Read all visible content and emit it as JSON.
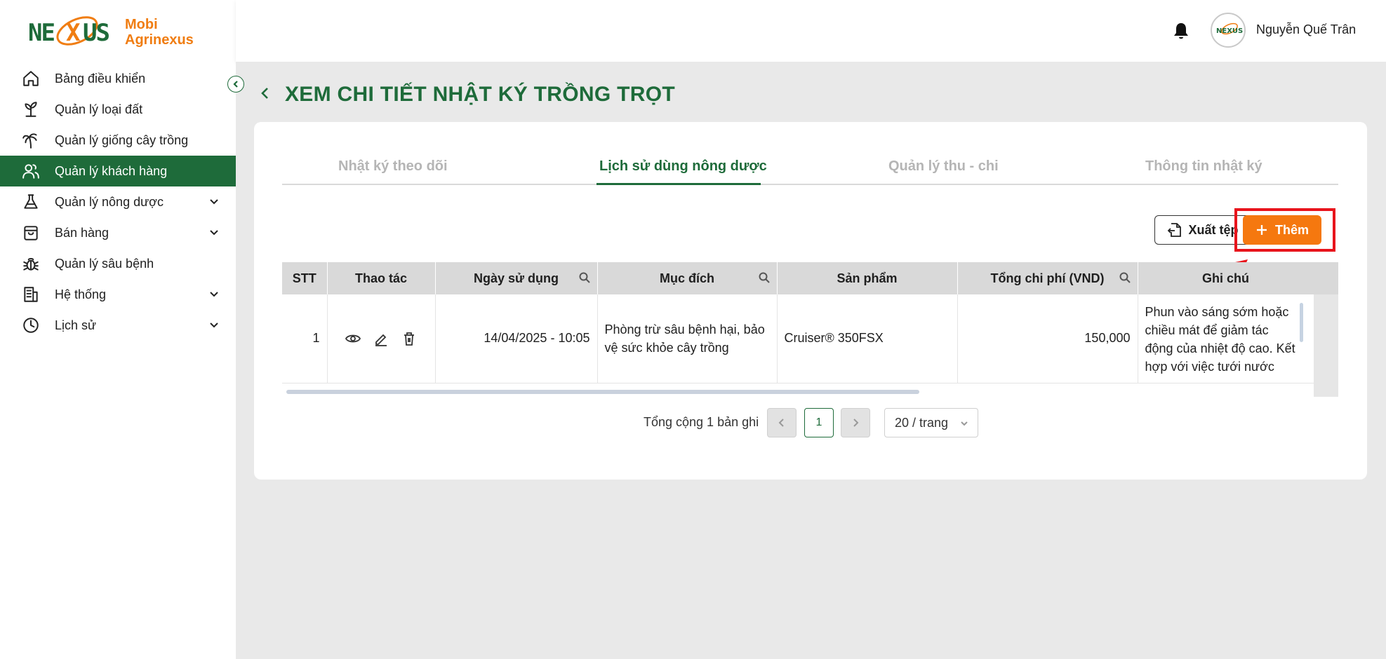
{
  "brand": {
    "logo_text": "NEXUS",
    "line1": "Mobi",
    "line2": "Agrinexus",
    "accent_color": "#f07d12",
    "primary_color": "#1e6b3a"
  },
  "sidebar": {
    "items": [
      {
        "label": "Bảng điều khiển",
        "icon": "home-icon"
      },
      {
        "label": "Quản lý loại đất",
        "icon": "sprout-icon"
      },
      {
        "label": "Quản lý giống cây trồng",
        "icon": "palm-tree-icon"
      },
      {
        "label": "Quản lý khách hàng",
        "icon": "users-icon",
        "active": true
      },
      {
        "label": "Quản lý nông dược",
        "icon": "flask-icon",
        "expandable": true
      },
      {
        "label": "Bán hàng",
        "icon": "shopping-bag-icon",
        "expandable": true
      },
      {
        "label": "Quản lý sâu bệnh",
        "icon": "bug-icon"
      },
      {
        "label": "Hệ thống",
        "icon": "building-icon",
        "expandable": true
      },
      {
        "label": "Lịch sử",
        "icon": "clock-icon",
        "expandable": true
      }
    ]
  },
  "header": {
    "user_name": "Nguyễn Quế Trân",
    "avatar_text": "NEXUS"
  },
  "page": {
    "title": "XEM CHI TIẾT NHẬT KÝ TRỒNG TRỌT"
  },
  "tabs": [
    {
      "label": "Nhật ký theo dõi"
    },
    {
      "label": "Lịch sử dùng nông dược",
      "active": true
    },
    {
      "label": "Quản lý thu - chi"
    },
    {
      "label": "Thông tin nhật ký"
    }
  ],
  "toolbar": {
    "export_label": "Xuất tệp",
    "add_label": "Thêm"
  },
  "table": {
    "headers": [
      "STT",
      "Thao tác",
      "Ngày sử dụng",
      "Mục đích",
      "Sản phẩm",
      "Tổng chi phí (VND)",
      "Ghi chú"
    ],
    "rows": [
      {
        "stt": "1",
        "date": "14/04/2025 - 10:05",
        "purpose": "Phòng trừ sâu bệnh hại, bảo vệ sức khỏe cây trồng",
        "product": "Cruiser® 350FSX",
        "cost": "150,000",
        "note": "Phun vào sáng sớm hoặc chiều mát để giảm tác động của nhiệt độ cao. Kết hợp với việc tưới nước đầy"
      }
    ]
  },
  "pagination": {
    "total_text": "Tổng cộng 1 bản ghi",
    "current_page": "1",
    "page_size": "20 / trang"
  }
}
